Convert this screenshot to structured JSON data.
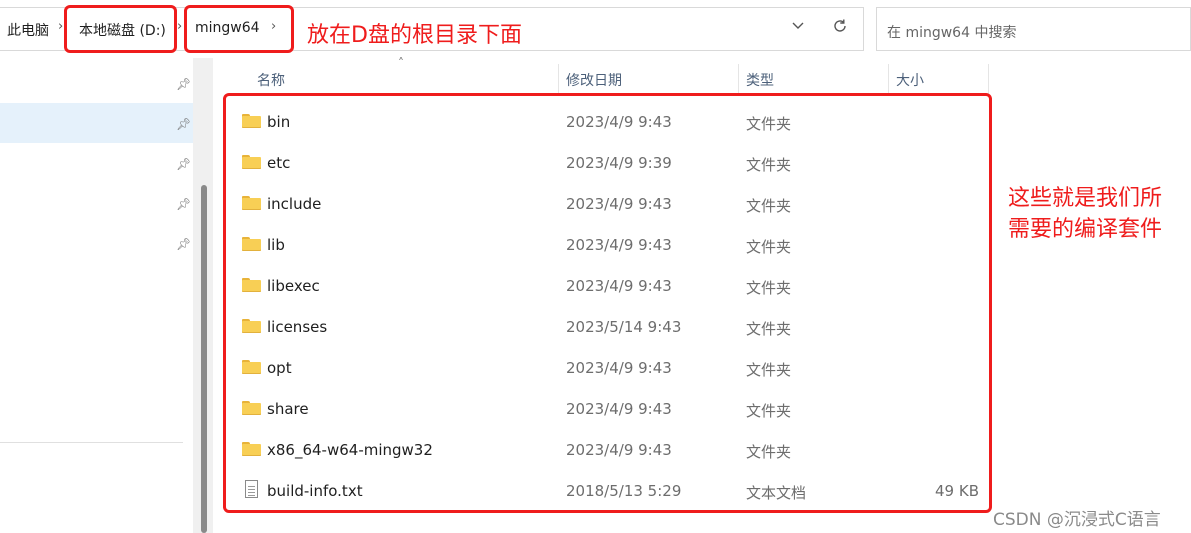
{
  "address_bar": {
    "crumbs": [
      "此电脑",
      "本地磁盘 (D:)",
      "mingw64"
    ],
    "separator": "›",
    "dropdown_icon": "chevron-down-icon",
    "refresh_icon": "refresh-icon"
  },
  "search": {
    "placeholder": "在 mingw64 中搜索"
  },
  "annotations": {
    "path_note": "放在D盘的根目录下面",
    "files_note": "这些就是我们所需要的编译套件",
    "highlight_color": "#ef1c1c"
  },
  "columns": {
    "name": "名称",
    "modified": "修改日期",
    "type": "类型",
    "size": "大小"
  },
  "files": [
    {
      "name": "bin",
      "modified": "2023/4/9 9:43",
      "type": "文件夹",
      "size": "",
      "icon": "folder-icon"
    },
    {
      "name": "etc",
      "modified": "2023/4/9 9:39",
      "type": "文件夹",
      "size": "",
      "icon": "folder-icon"
    },
    {
      "name": "include",
      "modified": "2023/4/9 9:43",
      "type": "文件夹",
      "size": "",
      "icon": "folder-icon"
    },
    {
      "name": "lib",
      "modified": "2023/4/9 9:43",
      "type": "文件夹",
      "size": "",
      "icon": "folder-icon"
    },
    {
      "name": "libexec",
      "modified": "2023/4/9 9:43",
      "type": "文件夹",
      "size": "",
      "icon": "folder-icon"
    },
    {
      "name": "licenses",
      "modified": "2023/5/14 9:43",
      "type": "文件夹",
      "size": "",
      "icon": "folder-icon"
    },
    {
      "name": "opt",
      "modified": "2023/4/9 9:43",
      "type": "文件夹",
      "size": "",
      "icon": "folder-icon"
    },
    {
      "name": "share",
      "modified": "2023/4/9 9:43",
      "type": "文件夹",
      "size": "",
      "icon": "folder-icon"
    },
    {
      "name": "x86_64-w64-mingw32",
      "modified": "2023/4/9 9:43",
      "type": "文件夹",
      "size": "",
      "icon": "folder-icon"
    },
    {
      "name": "build-info.txt",
      "modified": "2018/5/13 5:29",
      "type": "文本文档",
      "size": "49 KB",
      "icon": "text-file-icon"
    }
  ],
  "watermark": "CSDN @沉浸式C语言"
}
